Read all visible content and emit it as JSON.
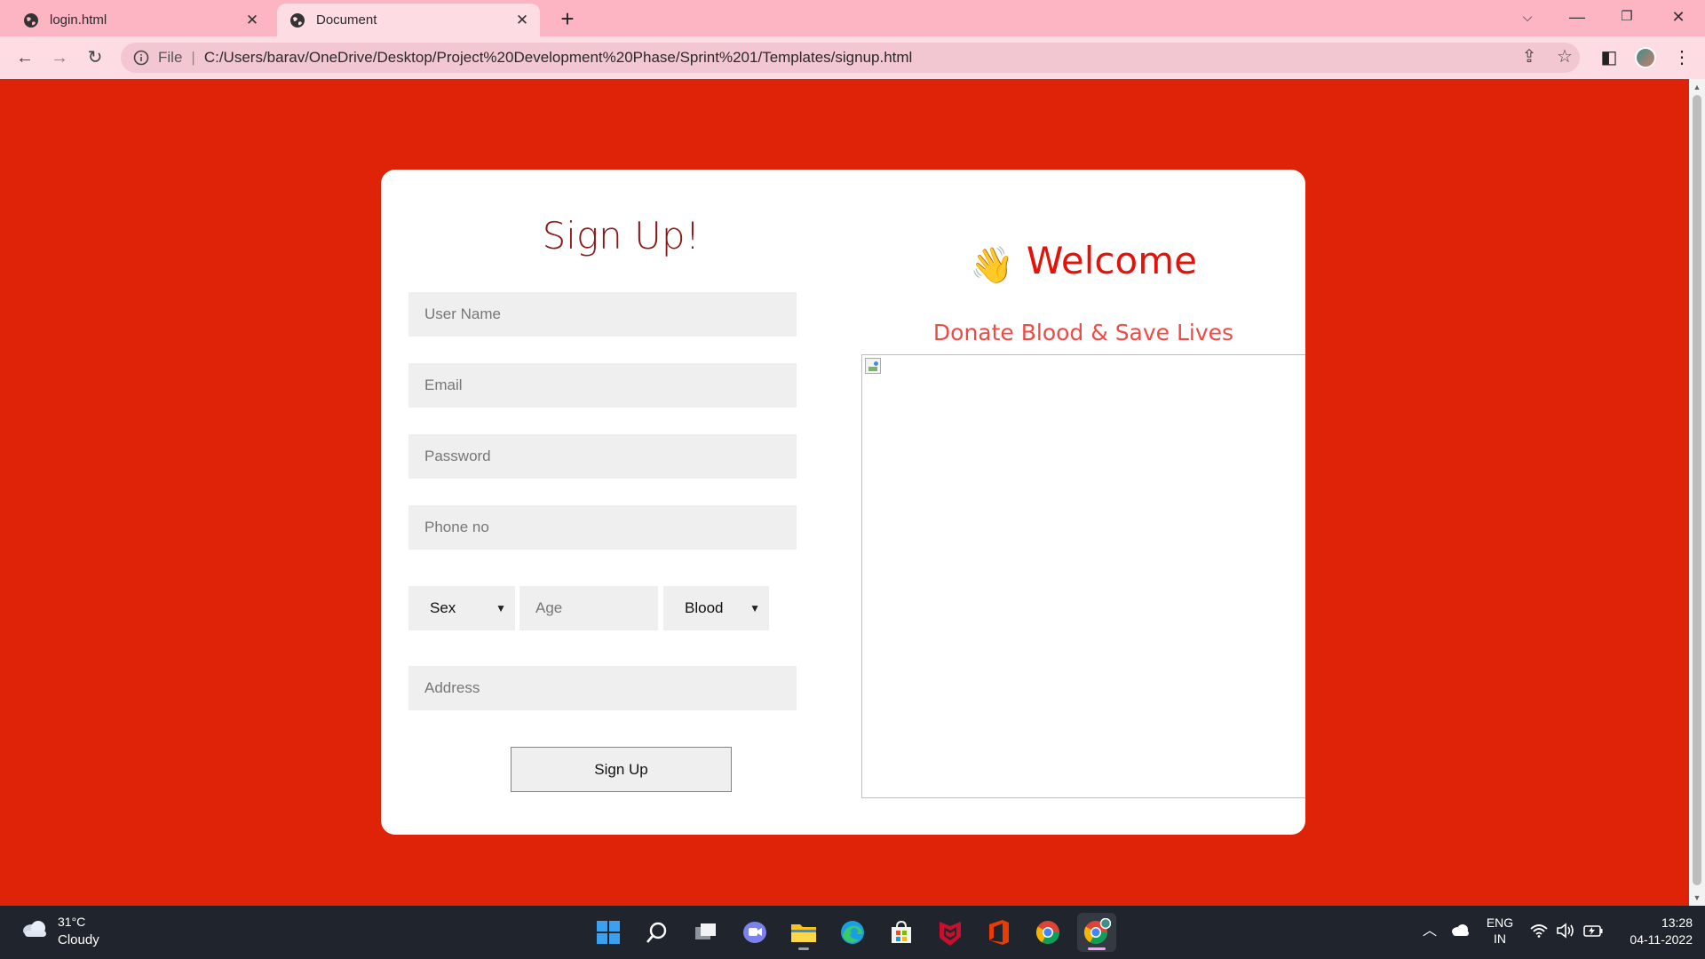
{
  "browser": {
    "tabs": [
      {
        "label": "login.html",
        "active": false
      },
      {
        "label": "Document",
        "active": true
      }
    ],
    "new_tab_icon": "plus-icon",
    "address": {
      "scheme": "File",
      "url": "C:/Users/barav/OneDrive/Desktop/Project%20Development%20Phase/Sprint%201/Templates/signup.html"
    }
  },
  "form": {
    "title": "Sign Up!",
    "username_placeholder": "User Name",
    "email_placeholder": "Email",
    "password_placeholder": "Password",
    "phone_placeholder": "Phone no",
    "sex_selected": "Sex",
    "age_placeholder": "Age",
    "blood_selected": "Blood",
    "address_placeholder": "Address",
    "submit_label": "Sign Up"
  },
  "welcome": {
    "wave_emoji": "👋",
    "heading": "Welcome",
    "tagline": "Donate Blood & Save Lives"
  },
  "taskbar": {
    "weather_temp": "31°C",
    "weather_condition": "Cloudy",
    "language_line1": "ENG",
    "language_line2": "IN",
    "time": "13:28",
    "date": "04-11-2022"
  },
  "colors": {
    "page_bg": "#de2308",
    "card_bg": "#ffffff",
    "title_color": "#8b1717",
    "welcome_color": "#e3120b",
    "tagline_color": "#ef4a44"
  }
}
